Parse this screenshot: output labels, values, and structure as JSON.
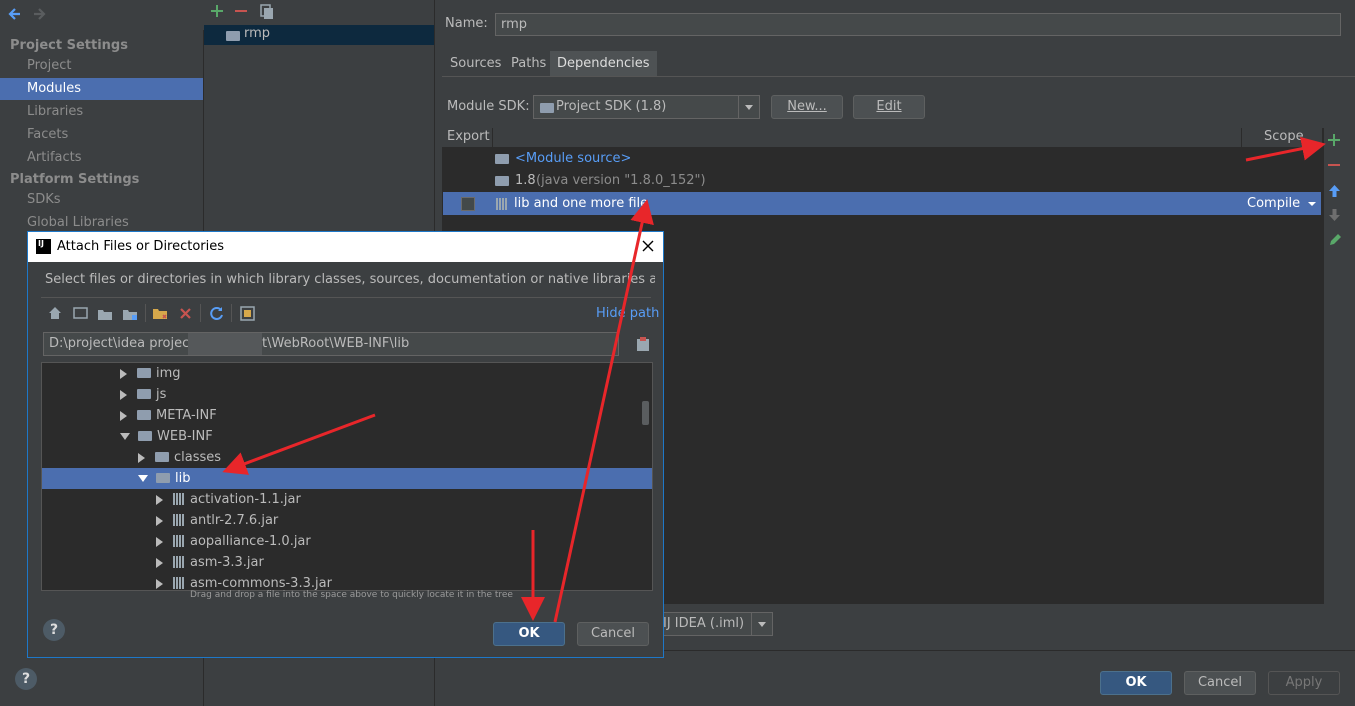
{
  "sidebar": {
    "project_settings_title": "Project Settings",
    "project_items": [
      "Project",
      "Modules",
      "Libraries",
      "Facets",
      "Artifacts"
    ],
    "platform_settings_title": "Platform Settings",
    "platform_items": [
      "SDKs",
      "Global Libraries"
    ]
  },
  "module_list": {
    "module_name": "rmp"
  },
  "module": {
    "name_label": "Name:",
    "name_value": "rmp",
    "tabs": [
      "Sources",
      "Paths",
      "Dependencies"
    ],
    "active_tab": "Dependencies",
    "sdk_label": "Module SDK:",
    "sdk_value": "Project SDK (1.8)",
    "new_button": "New...",
    "edit_button": "Edit",
    "table_header_export": "Export",
    "table_header_scope": "Scope",
    "dependencies": [
      {
        "label": "<Module source>",
        "extra": ""
      },
      {
        "label": "1.8",
        "extra": "(java version \"1.8.0_152\")"
      },
      {
        "label": "lib and one more file",
        "extra": "",
        "scope": "Compile"
      }
    ],
    "format_value": "IJ IDEA (.iml)"
  },
  "footer": {
    "ok": "OK",
    "cancel": "Cancel",
    "apply": "Apply",
    "help": "?"
  },
  "dialog": {
    "title": "Attach Files or Directories",
    "description": "Select files or directories in which library classes, sources, documentation or native libraries are located",
    "hide_path": "Hide path",
    "path_part1": "D:\\project\\idea project\\",
    "path_part2": "t\\WebRoot\\WEB-INF\\lib",
    "tree": [
      {
        "label": "img",
        "indent": 1,
        "expanded": false,
        "kind": "folder"
      },
      {
        "label": "js",
        "indent": 1,
        "expanded": false,
        "kind": "folder"
      },
      {
        "label": "META-INF",
        "indent": 1,
        "expanded": false,
        "kind": "folder"
      },
      {
        "label": "WEB-INF",
        "indent": 1,
        "expanded": true,
        "kind": "folder"
      },
      {
        "label": "classes",
        "indent": 2,
        "expanded": false,
        "kind": "folder"
      },
      {
        "label": "lib",
        "indent": 2,
        "expanded": true,
        "kind": "folder",
        "selected": true
      },
      {
        "label": "activation-1.1.jar",
        "indent": 3,
        "expanded": false,
        "kind": "jar"
      },
      {
        "label": "antlr-2.7.6.jar",
        "indent": 3,
        "expanded": false,
        "kind": "jar"
      },
      {
        "label": "aopalliance-1.0.jar",
        "indent": 3,
        "expanded": false,
        "kind": "jar"
      },
      {
        "label": "asm-3.3.jar",
        "indent": 3,
        "expanded": false,
        "kind": "jar"
      },
      {
        "label": "asm-commons-3.3.jar",
        "indent": 3,
        "expanded": false,
        "kind": "jar"
      }
    ],
    "drag_hint": "Drag and drop a file into the space above to quickly locate it in the tree",
    "ok": "OK",
    "cancel": "Cancel",
    "help": "?"
  },
  "colors": {
    "selection": "#4b6eaf",
    "accent_blue": "#589df6",
    "annotation_red": "#e8262a",
    "add_green": "#59a869"
  }
}
